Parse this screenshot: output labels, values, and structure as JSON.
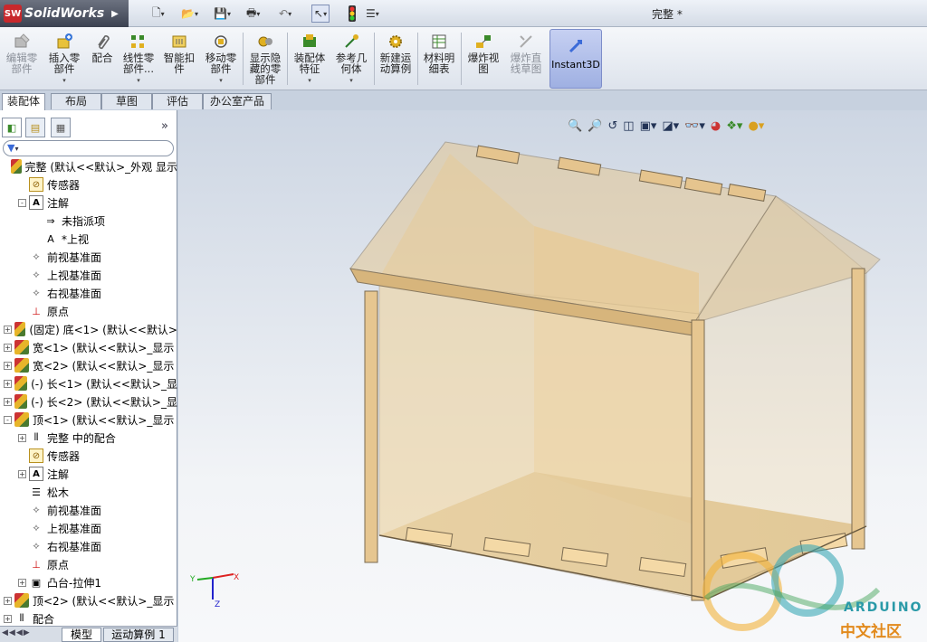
{
  "app": {
    "name": "SolidWorks",
    "logo_text": "SW",
    "document_title": "完整 *"
  },
  "command_manager": {
    "buttons": [
      {
        "id": "edit-component",
        "label1": "编辑零",
        "label2": "部件",
        "enabled": false
      },
      {
        "id": "insert-component",
        "label1": "插入零",
        "label2": "部件",
        "enabled": true
      },
      {
        "id": "mate",
        "label1": "配合",
        "label2": "",
        "enabled": true
      },
      {
        "id": "linear-pattern",
        "label1": "线性零",
        "label2": "部件...",
        "enabled": true
      },
      {
        "id": "smart-fasteners",
        "label1": "智能扣",
        "label2": "件",
        "enabled": true
      },
      {
        "id": "move-component",
        "label1": "移动零",
        "label2": "部件",
        "enabled": true
      },
      {
        "id": "show-hidden",
        "label1": "显示隐",
        "label2": "藏的零",
        "label3": "部件",
        "enabled": true
      },
      {
        "id": "assembly-features",
        "label1": "装配体",
        "label2": "特征",
        "enabled": true
      },
      {
        "id": "reference-geometry",
        "label1": "参考几",
        "label2": "何体",
        "enabled": true
      },
      {
        "id": "new-motion-study",
        "label1": "新建运",
        "label2": "动算例",
        "enabled": true
      },
      {
        "id": "bom",
        "label1": "材料明",
        "label2": "细表",
        "enabled": true
      },
      {
        "id": "exploded-view",
        "label1": "爆炸视",
        "label2": "图",
        "enabled": true
      },
      {
        "id": "explode-line-sketch",
        "label1": "爆炸直",
        "label2": "线草图",
        "enabled": false
      },
      {
        "id": "instant3d",
        "label1": "Instant3D",
        "label2": "",
        "enabled": true
      }
    ],
    "tabs": [
      "装配体",
      "布局",
      "草图",
      "评估",
      "办公室产品"
    ],
    "active_tab": "装配体"
  },
  "tree": {
    "filter_icon": "filter-icon",
    "items": [
      {
        "level": 0,
        "expander": "",
        "icon": "assembly",
        "text": "完整  (默认<<默认>_外观 显示"
      },
      {
        "level": 1,
        "expander": "",
        "icon": "sensor",
        "text": "传感器"
      },
      {
        "level": 1,
        "expander": "-",
        "icon": "note",
        "text": "注解"
      },
      {
        "level": 2,
        "expander": "",
        "icon": "arrow-a",
        "text": "未指派项"
      },
      {
        "level": 2,
        "expander": "",
        "icon": "a",
        "text": "*上视"
      },
      {
        "level": 1,
        "expander": "",
        "icon": "plane",
        "text": "前视基准面"
      },
      {
        "level": 1,
        "expander": "",
        "icon": "plane",
        "text": "上视基准面"
      },
      {
        "level": 1,
        "expander": "",
        "icon": "plane",
        "text": "右视基准面"
      },
      {
        "level": 1,
        "expander": "",
        "icon": "origin",
        "text": "原点"
      },
      {
        "level": 0,
        "expander": "+",
        "icon": "assembly",
        "text": "(固定) 底<1> (默认<<默认>"
      },
      {
        "level": 0,
        "expander": "+",
        "icon": "assembly",
        "text": "宽<1> (默认<<默认>_显示"
      },
      {
        "level": 0,
        "expander": "+",
        "icon": "assembly",
        "text": "宽<2> (默认<<默认>_显示"
      },
      {
        "level": 0,
        "expander": "+",
        "icon": "assembly",
        "text": "(-) 长<1> (默认<<默认>_显"
      },
      {
        "level": 0,
        "expander": "+",
        "icon": "assembly",
        "text": "(-) 长<2> (默认<<默认>_显"
      },
      {
        "level": 0,
        "expander": "-",
        "icon": "assembly",
        "text": "顶<1> (默认<<默认>_显示"
      },
      {
        "level": 1,
        "expander": "+",
        "icon": "mates",
        "text": "完整 中的配合"
      },
      {
        "level": 1,
        "expander": "",
        "icon": "sensor",
        "text": "传感器"
      },
      {
        "level": 1,
        "expander": "+",
        "icon": "note",
        "text": "注解"
      },
      {
        "level": 1,
        "expander": "",
        "icon": "material",
        "text": "松木"
      },
      {
        "level": 1,
        "expander": "",
        "icon": "plane",
        "text": "前视基准面"
      },
      {
        "level": 1,
        "expander": "",
        "icon": "plane",
        "text": "上视基准面"
      },
      {
        "level": 1,
        "expander": "",
        "icon": "plane",
        "text": "右视基准面"
      },
      {
        "level": 1,
        "expander": "",
        "icon": "origin",
        "text": "原点"
      },
      {
        "level": 1,
        "expander": "+",
        "icon": "extrude",
        "text": "凸台-拉伸1"
      },
      {
        "level": 0,
        "expander": "+",
        "icon": "assembly",
        "text": "顶<2> (默认<<默认>_显示"
      },
      {
        "level": 0,
        "expander": "+",
        "icon": "mates",
        "text": "配合"
      }
    ]
  },
  "bottom_tabs": [
    "模型",
    "运动算例 1"
  ],
  "watermark": {
    "text1": "ARDUINO",
    "text2": "中文社区"
  },
  "triad": {
    "x": "X",
    "y": "Y",
    "z": "Z"
  }
}
